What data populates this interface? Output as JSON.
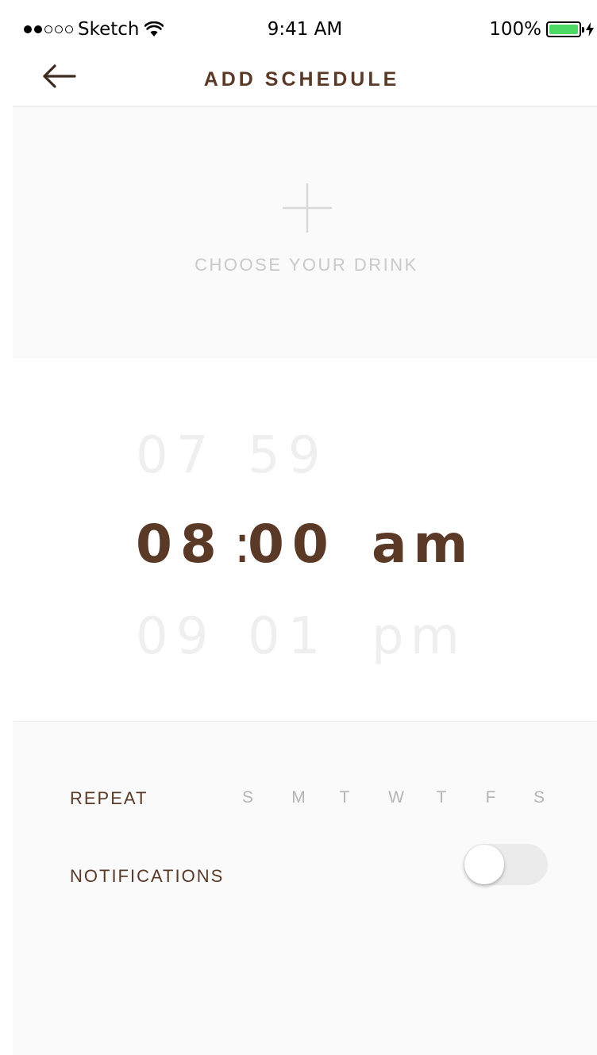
{
  "status_bar": {
    "carrier": "Sketch",
    "time": "9:41 AM",
    "battery": "100%",
    "signal_icon": "signal-dots-icon",
    "wifi_icon": "wifi-icon",
    "battery_icon": "battery-icon",
    "charging_icon": "charging-bolt-icon"
  },
  "nav": {
    "title": "ADD SCHEDULE",
    "back_icon": "arrow-left-icon"
  },
  "drink": {
    "label": "CHOOSE YOUR DRINK",
    "icon": "plus-icon"
  },
  "time_picker": {
    "previous": {
      "hour": "07",
      "minute": "59"
    },
    "current": {
      "hour": "08",
      "separator": ":",
      "minute": "00",
      "period": "am"
    },
    "next": {
      "hour": "09",
      "minute": "01",
      "period": "pm"
    }
  },
  "options": {
    "repeat_label": "REPEAT",
    "days": [
      "S",
      "M",
      "T",
      "W",
      "T",
      "F",
      "S"
    ],
    "notifications_label": "NOTIFICATIONS",
    "notifications_on": false
  },
  "colors": {
    "accent": "#5a3a26",
    "muted": "#c9c9c9",
    "faded": "#efefef",
    "battery": "#4cd964"
  }
}
